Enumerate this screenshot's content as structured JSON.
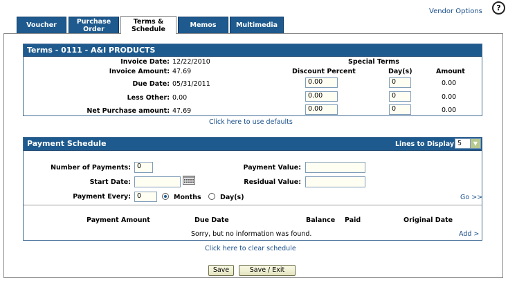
{
  "header": {
    "vendor_options": "Vendor Options",
    "help": "?"
  },
  "tabs": [
    {
      "label": "Voucher"
    },
    {
      "label": "Purchase Order"
    },
    {
      "label": "Terms & Schedule"
    },
    {
      "label": "Memos"
    },
    {
      "label": "Multimedia"
    }
  ],
  "terms": {
    "title": "Terms -  0111 - A&I PRODUCTS",
    "invoice_date_label": "Invoice Date:",
    "invoice_date": "12/22/2010",
    "invoice_amount_label": "Invoice Amount:",
    "invoice_amount": "47.69",
    "due_date_label": "Due Date:",
    "due_date": "05/31/2011",
    "less_other_label": "Less Other:",
    "less_other": "0.00",
    "net_purchase_label": "Net Purchase amount:",
    "net_purchase": "47.69",
    "special_terms": "Special Terms",
    "col_discount": "Discount Percent",
    "col_days": "Day(s)",
    "col_amount": "Amount",
    "rows": [
      {
        "discount": "0.00",
        "days": "0",
        "amount": "0.00"
      },
      {
        "discount": "0.00",
        "days": "0",
        "amount": "0.00"
      },
      {
        "discount": "0.00",
        "days": "0",
        "amount": "0.00"
      }
    ],
    "defaults_link": "Click here to use defaults"
  },
  "schedule": {
    "title": "Payment Schedule",
    "lines_label": "Lines to Display:",
    "lines_value": "5",
    "num_payments_label": "Number of Payments:",
    "num_payments": "0",
    "start_date_label": "Start Date:",
    "start_date": "",
    "payment_every_label": "Payment Every:",
    "payment_every": "0",
    "months_label": "Months",
    "days_label": "Day(s)",
    "payment_value_label": "Payment Value:",
    "payment_value": "",
    "residual_value_label": "Residual Value:",
    "residual_value": "",
    "go_link": "Go >>",
    "col_payment_amount": "Payment Amount",
    "col_due_date": "Due Date",
    "col_balance": "Balance",
    "col_paid": "Paid",
    "col_original_date": "Original Date",
    "empty_message": "Sorry, but no information was found.",
    "add_link": "Add >",
    "clear_link": "Click here to clear schedule"
  },
  "buttons": {
    "save": "Save",
    "save_exit": "Save / Exit"
  }
}
